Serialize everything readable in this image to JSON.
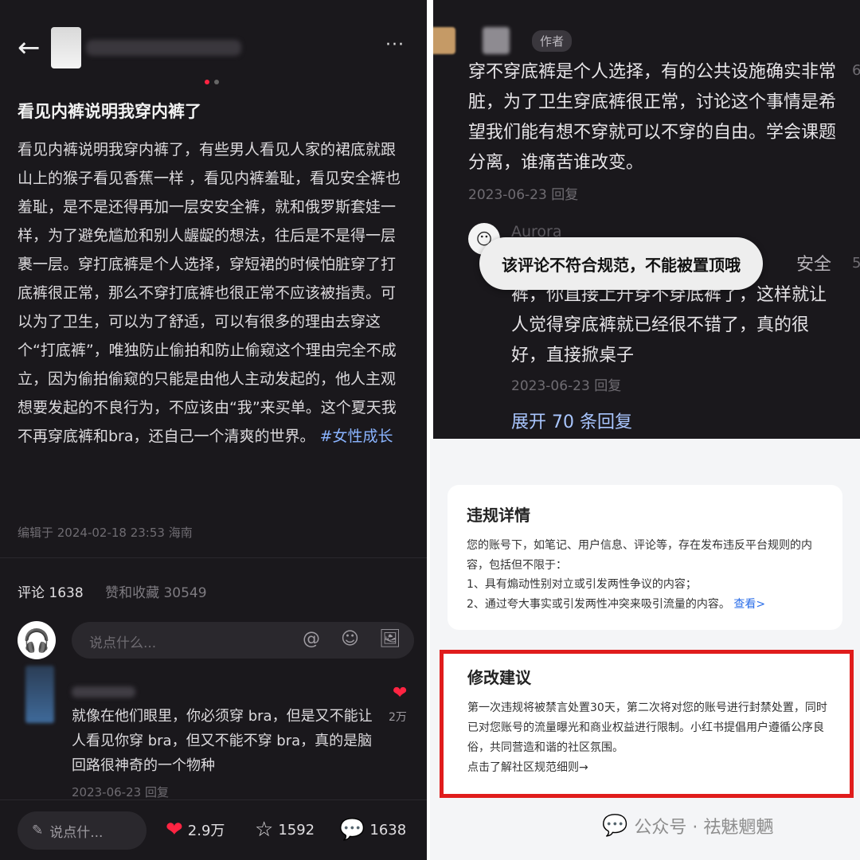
{
  "left": {
    "back_icon": "←",
    "more_icon": "···",
    "post_title": "看见内裤说明我穿内裤了",
    "post_body": "看见内裤说明我穿内裤了，有些男人看见人家的裙底就跟山上的猴子看见香蕉一样 ，看见内裤羞耻，看见安全裤也羞耻，是不是还得再加一层安安全裤，就和俄罗斯套娃一样，为了避免尴尬和别人龌龊的想法，往后是不是得一层裹一层。穿打底裤是个人选择，穿短裙的时候怕脏穿了打底裤很正常，那么不穿打底裤也很正常不应该被指责。可以为了卫生，可以为了舒适，可以有很多的理由去穿这个“打底裤”，唯独防止偷拍和防止偷窥这个理由完全不成立，因为偷拍偷窥的只能是由他人主动发起的，他人主观想要发起的不良行为，不应该由“我”来买单。这个夏天我不再穿底裤和bra，还自己一个清爽的世界。",
    "post_tag": "#女性成长",
    "edited": "编辑于 2024-02-18 23:53 海南",
    "comments_label": "评论 1638",
    "favs_label": "赞和收藏 30549",
    "comment_placeholder": "说点什么...",
    "comment": {
      "text": "就像在他们眼里，你必须穿 bra，但是又不能让人看见你穿 bra，但又不能不穿 bra，真的是脑回路很神奇的一个物种",
      "date": "2023-06-23 回复",
      "likes": "2万"
    },
    "bottom": {
      "say": "说点什...",
      "likes": "2.9万",
      "stars": "1592",
      "comments": "1638"
    }
  },
  "right_top": {
    "author_tag": "作者",
    "reply_text": "穿不穿底裤是个人选择，有的公共设施确实非常脏，为了卫生穿底裤很正常，讨论这个事情是希望我们能有想不穿就可以不穿的自由。学会课题分离，谁痛苦谁改变。",
    "reply_date": "2023-06-23 回复",
    "side_num1": "6",
    "side_num2": "5",
    "aurora_name": "Aurora",
    "aurora_reply_line1": "安全",
    "aurora_reply_rest": "裤，你直接上升穿不穿底裤了，这样就让人觉得穿底裤就已经很不错了，真的很好，直接掀桌子",
    "aurora_date": "2023-06-23 回复",
    "expand": "展开 70 条回复",
    "toast": "该评论不符合规范，不能被置顶哦"
  },
  "right_bottom": {
    "violation_title": "违规详情",
    "violation_body": "您的账号下，如笔记、用户信息、评论等，存在发布违反平台规则的内容，包括但不限于：",
    "violation_item1": "1、具有煽动性别对立或引发两性争议的内容；",
    "violation_item2": "2、通过夸大事实或引发两性冲突来吸引流量的内容。",
    "violation_link": "查看>",
    "advice_title": "修改建议",
    "advice_body": "第一次违规将被禁言处置30天，第二次将对您的账号进行封禁处置，同时已对您账号的流量曝光和商业权益进行限制。小红书提倡用户遵循公序良俗，共同营造和谐的社区氛围。",
    "advice_link": "点击了解社区规范细则→",
    "watermark": "公众号 · 祛魅魍魉"
  },
  "colors": {
    "accent_red": "#ff2442",
    "link_blue": "#2a6de8",
    "box_red": "#e01c1c"
  }
}
